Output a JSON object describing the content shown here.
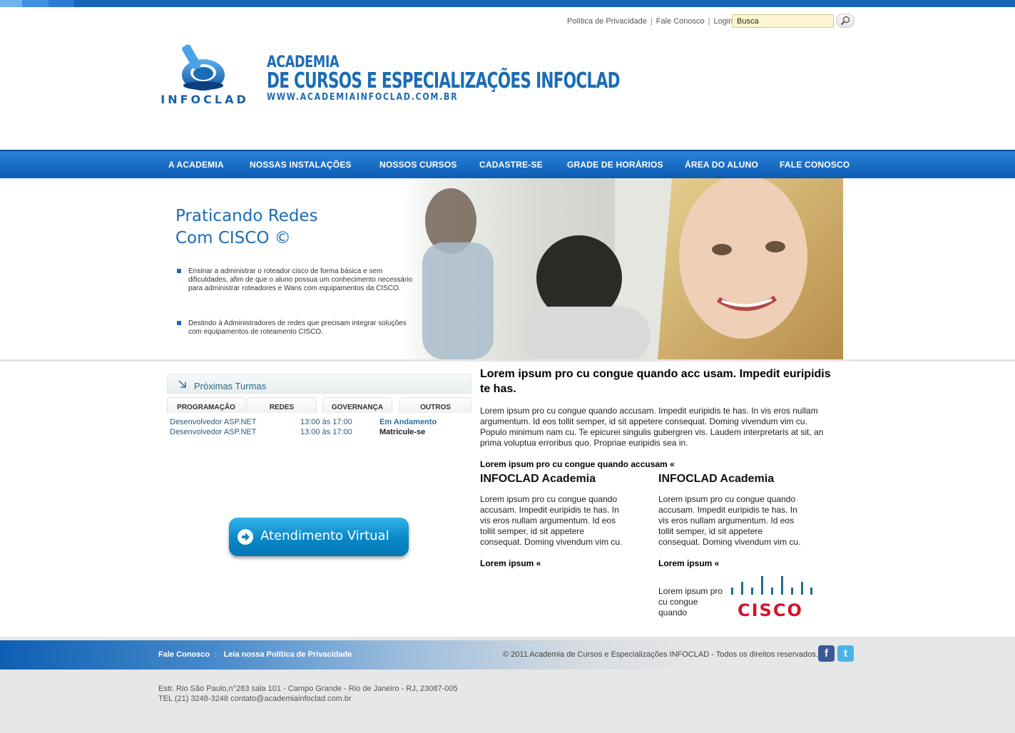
{
  "header": {
    "links": [
      "Política de Privacidade",
      "Fale Conosco",
      "Login"
    ],
    "search_value": "Busca",
    "logo_text": "INFOCLAD",
    "brand_line1": "ACADEMIA",
    "brand_line2": "DE CURSOS E ESPECIALIZAÇÕES INFOCLAD",
    "brand_line3": "WWW.ACADEMIAINFOCLAD.COM.BR"
  },
  "nav": [
    "A ACADEMIA",
    "NOSSAS INSTALAÇÕES",
    "NOSSOS CURSOS",
    "CADASTRE-SE",
    "GRADE DE HORÁRIOS",
    "ÁREA DO ALUNO",
    "FALE CONOSCO"
  ],
  "banner": {
    "title1": "Praticando Redes",
    "title2": "Com CISCO ©",
    "bullets": [
      "Ensinar a administrar o roteador cisco de forma básica e sem dificuldades, afim de que o aluno possua um conhecimento necessário para administrar roteadores e Wans com equipamentos da CISCO.",
      "Destindo à Administradores de redes que precisam integrar soluções com equipamentos de roteamento CISCO."
    ]
  },
  "turmas": {
    "title": "Próximas Turmas",
    "tabs": [
      "PROGRAMAÇÃO",
      "REDES",
      "GOVERNANÇA",
      "OUTROS"
    ],
    "rows": [
      {
        "course": "Desenvolvedor ASP.NET",
        "time": "13:00 às 17:00",
        "status": "Em Andamento",
        "color": "#2f6e9c"
      },
      {
        "course": "Desenvolvedor ASP.NET",
        "time": "13:00 às 17:00",
        "status": "Matricule-se",
        "color": "#222222"
      }
    ]
  },
  "atendimento": "Atendimento Virtual",
  "main": {
    "heading": "Lorem ipsum pro cu congue quando acc usam. Impedit euripidis te has.",
    "body": "Lorem ipsum pro cu congue quando accusam. Impedit euripidis te has. In vis eros nullam argumentum. Id eos tollit semper, id sit appetere consequat. Doming vivendum vim cu. Populo minimum nam cu. Te epicurei singulis gubergren vis. Laudem interpretaris at sit, an prima voluptua erroribus quo. Propriae euripidis sea in.",
    "more": "Lorem ipsum pro cu congue quando accusam «",
    "col1": {
      "title": "INFOCLAD Academia",
      "text": "Lorem ipsum pro cu congue quando accusam. Impedit euripidis te has. In vis eros nullam argumentum. Id eos tollit semper, id sit appetere consequat. Doming vivendum vim cu.",
      "more": "Lorem ipsum «"
    },
    "col2": {
      "title": "INFOCLAD Academia",
      "text": "Lorem ipsum pro cu congue quando accusam. Impedit euripidis te has. In vis eros nullam argumentum. Id eos tollit semper, id sit appetere consequat. Doming vivendum vim cu.",
      "more": "Lorem ipsum «",
      "cisco_caption": "Lorem ipsum pro cu congue quando",
      "cisco_logo": "CISCO"
    }
  },
  "footer": {
    "link1": "Fale Conosco",
    "sep": "::",
    "link2": "Leia nossa Política de Privacidade",
    "copyright": "© 2011 Academia de Cursos e Especializações INFOCLAD - Todos os direitos reservados.",
    "facebook_icon": "facebook-icon",
    "twitter_icon": "twitter-icon",
    "address": "Estr. Rio São Paulo,n°283 sala 101 - Campo Grande - Rio de Janeiro - RJ, 23087-005",
    "phone": "TEL (21) 3248-3248 contato@academiainfoclad.com.br"
  },
  "colors": {
    "brand_blue": "#1b6cb5",
    "nav_blue": "#1565b8",
    "search_bg": "#fdf5d0",
    "cisco_red": "#d2142a",
    "cisco_teal": "#1f6f89"
  }
}
